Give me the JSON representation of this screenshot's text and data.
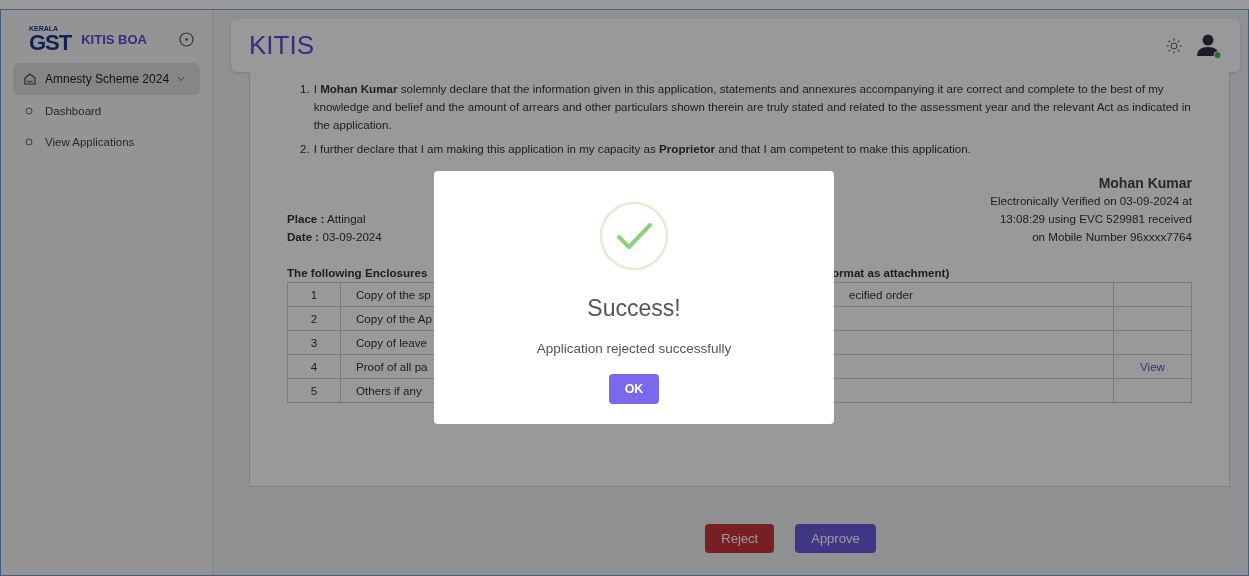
{
  "sidebar": {
    "logo": {
      "state": "KERALA",
      "mark": "GST"
    },
    "app_name": "KITIS BOA",
    "menu": [
      {
        "label": "Amnesty Scheme 2024",
        "expanded": true,
        "selected": true,
        "children": [
          {
            "label": "Dashboard",
            "selected": false
          },
          {
            "label": "View Applications",
            "selected": false
          }
        ]
      }
    ]
  },
  "header": {
    "title": "KITIS"
  },
  "declarations": [
    "I **Mohan Kumar** solemnly declare that the information given in this application, statements and annexures accompanying it are correct and complete to the best of my knowledge and belief and the amount of arrears and other particulars shown therein are truly stated and related to the assessment year and the relevant Act as indicated in the application.",
    "I further declare that I am making this application in my capacity as **Proprietor** and that I am competent to make this application."
  ],
  "declaration_numbers": [
    "1.",
    "2."
  ],
  "place": "**Place :** Attingal",
  "date": "**Date :** 03-09-2024",
  "signature": {
    "name": "Mohan Kumar",
    "lines": [
      "Electronically Verified on 03-09-2024 at",
      "13:08:29 using EVC 529981 received",
      "on Mobile Number 96xxxx7764"
    ]
  },
  "enclosures": {
    "heading_left": "The following Enclosures",
    "heading_right": "ormat as attachment)",
    "rows": [
      {
        "number": "1",
        "description": "Copy of the sp",
        "description_right": "ecified order"
      },
      {
        "number": "2",
        "description": "Copy of the Ap"
      },
      {
        "number": "3",
        "description": "Copy of leave"
      },
      {
        "number": "4",
        "description": "Proof of all pa",
        "link": "View"
      },
      {
        "number": "5",
        "description": "Others if any"
      }
    ]
  },
  "actions": [
    {
      "label": "Reject",
      "kind": "danger"
    },
    {
      "label": "Approve",
      "kind": "primary"
    }
  ],
  "dialog": {
    "title": "Success!",
    "message": "Application rejected successfully",
    "button": "OK"
  }
}
